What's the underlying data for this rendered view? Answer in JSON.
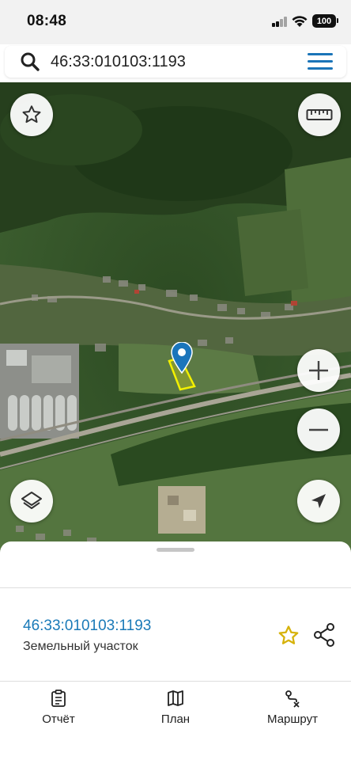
{
  "status_bar": {
    "time": "08:48",
    "battery": "100"
  },
  "search": {
    "value": "46:33:010103:1193",
    "icon": "search-icon",
    "menu_icon": "hamburger-menu-icon",
    "accent_color": "#1a74b8"
  },
  "map": {
    "controls": [
      "favorite-star-icon",
      "ruler-icon",
      "zoom-in-icon",
      "zoom-out-icon",
      "layers-icon",
      "locate-icon"
    ],
    "marker_color": "#1b75bb",
    "parcel_outline_color": "#f3f000"
  },
  "sheet": {
    "parcel_number": "46:33:010103:1193",
    "parcel_type": "Земельный участок",
    "favorite_color": "#d6b20a"
  },
  "tabs": [
    {
      "label": "Отчёт",
      "icon": "report-icon"
    },
    {
      "label": "План",
      "icon": "map-plan-icon"
    },
    {
      "label": "Маршрут",
      "icon": "route-icon"
    }
  ]
}
